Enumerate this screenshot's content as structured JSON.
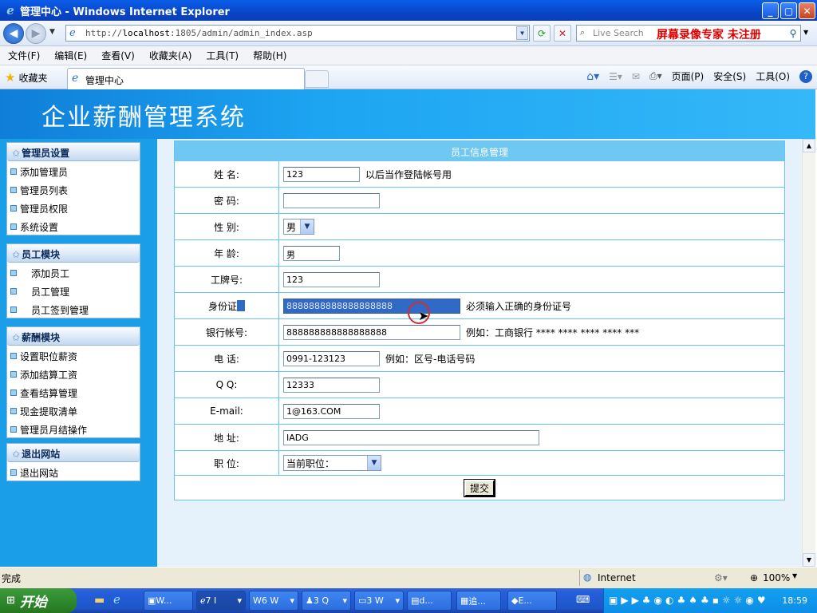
{
  "window": {
    "title": "管理中心 - Windows Internet Explorer",
    "min_glyph": "_",
    "max_glyph": "▢",
    "close_glyph": "✕"
  },
  "address": {
    "prefix": "http://",
    "host": "localhost",
    "path": ":1805/admin/admin_index.asp",
    "search_placeholder": "Live Search",
    "watermark": "屏幕录像专家 未注册"
  },
  "menu": [
    "文件(F)",
    "编辑(E)",
    "查看(V)",
    "收藏夹(A)",
    "工具(T)",
    "帮助(H)"
  ],
  "tabs": {
    "favorites": "收藏夹",
    "active_tab": "管理中心"
  },
  "commands": {
    "page": "页面(P)",
    "safety": "安全(S)",
    "tools": "工具(O)"
  },
  "banner": {
    "title": "企业薪酬管理系统"
  },
  "sidebar": {
    "sections": [
      {
        "title": "管理员设置",
        "items": [
          "添加管理员",
          "管理员列表",
          "管理员权限",
          "系统设置"
        ]
      },
      {
        "title": "员工模块",
        "items": [
          "添加员工",
          "员工管理",
          "员工签到管理"
        ]
      },
      {
        "title": "薪酬模块",
        "items": [
          "设置职位薪资",
          "添加结算工资",
          "查看结算管理",
          "现金提取清单",
          "管理员月结操作"
        ]
      },
      {
        "title": "退出网站",
        "items": [
          "退出网站"
        ]
      }
    ]
  },
  "form": {
    "caption": "员工信息管理",
    "fields": [
      {
        "label": "姓  名:",
        "value": "123",
        "note": "以后当作登陆帐号用"
      },
      {
        "label": "密  码:",
        "value": "",
        "note": ""
      },
      {
        "label": "性  别:",
        "value": "男",
        "note": ""
      },
      {
        "label": "年  龄:",
        "value": "男",
        "note": ""
      },
      {
        "label": "工牌号:",
        "value": "123",
        "note": ""
      },
      {
        "label": "身份证:",
        "value": "8888888888888888888",
        "note": "必须输入正确的身份证号"
      },
      {
        "label": "银行帐号:",
        "value": "888888888888888888",
        "note": "例如：工商银行 **** **** **** **** ***"
      },
      {
        "label": "电  话:",
        "value": "0991-123123",
        "note": "例如：区号-电话号码"
      },
      {
        "label": "Q Q:",
        "value": "12333",
        "note": ""
      },
      {
        "label": "E-mail:",
        "value": "1@163.COM",
        "note": ""
      },
      {
        "label": "地  址:",
        "value": "IADG",
        "note": ""
      },
      {
        "label": "职  位:",
        "value": "当前职位：",
        "note": ""
      }
    ],
    "submit": "提交"
  },
  "status": {
    "text": "完成",
    "zone": "Internet",
    "zoom": "100%"
  },
  "taskbar": {
    "start": "开始",
    "buttons": [
      "W...",
      "7 I",
      "6 W",
      "3 Q",
      "3 W",
      "d...",
      "追...",
      "E..."
    ],
    "clock": "18:59"
  },
  "colors": {
    "banner": "#1da5f2",
    "sidebar": "#1a9ee8",
    "form_border": "#66c4ef",
    "watermark": "#e00000"
  }
}
